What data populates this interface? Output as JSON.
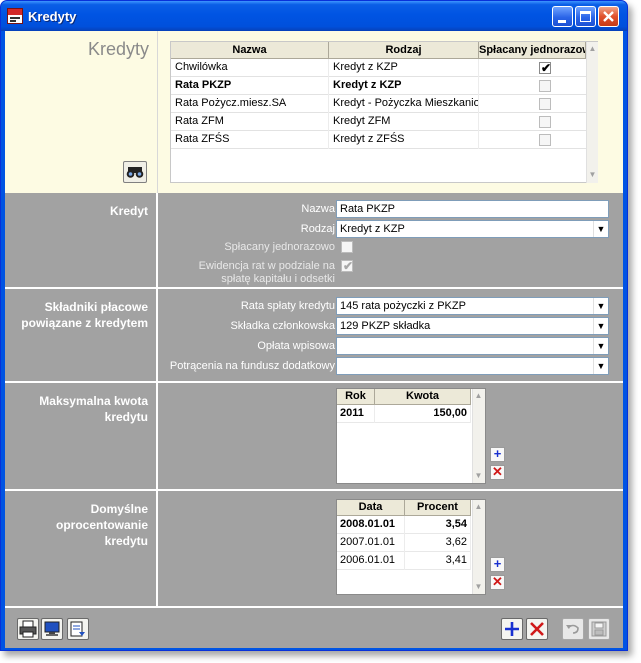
{
  "window": {
    "title": "Kredyty"
  },
  "page_title": "Kredyty",
  "list": {
    "columns": [
      "Nazwa",
      "Rodzaj",
      "Spłacany jednorazowo"
    ],
    "rows": [
      {
        "nazwa": "Chwilówka",
        "rodzaj": "Kredyt z KZP",
        "jednorazowo": true,
        "selected": false
      },
      {
        "nazwa": "Rata PKZP",
        "rodzaj": "Kredyt z KZP",
        "jednorazowo": false,
        "selected": true
      },
      {
        "nazwa": "Rata Pożycz.miesz.SA",
        "rodzaj": "Kredyt - Pożyczka Mieszkanio",
        "jednorazowo": false,
        "selected": false
      },
      {
        "nazwa": "Rata ZFM",
        "rodzaj": "Kredyt ZFM",
        "jednorazowo": false,
        "selected": false
      },
      {
        "nazwa": "Rata ZFŚS",
        "rodzaj": "Kredyt z ZFŚS",
        "jednorazowo": false,
        "selected": false
      }
    ]
  },
  "kredyt": {
    "section_label": "Kredyt",
    "nazwa_label": "Nazwa",
    "nazwa_value": "Rata PKZP",
    "rodzaj_label": "Rodzaj",
    "rodzaj_value": "Kredyt z KZP",
    "jednorazowo_label": "Spłacany jednorazowo",
    "jednorazowo_checked": false,
    "ewidencja_label_1": "Ewidencja rat w podziale na",
    "ewidencja_label_2": "spłatę kapitału i odsetki",
    "ewidencja_checked": true
  },
  "skladniki": {
    "section_label": "Składniki płacowe powiązane z kredytem",
    "rata_label": "Rata spłaty kredytu",
    "rata_value": "145 rata pożyczki z PKZP",
    "skladka_label": "Składka członkowska",
    "skladka_value": "129 PKZP składka",
    "oplata_label": "Opłata wpisowa",
    "oplata_value": "",
    "potracenia_label": "Potrącenia na fundusz dodatkowy",
    "potracenia_value": ""
  },
  "maks": {
    "section_label": "Maksymalna kwota kredytu",
    "columns": [
      "Rok",
      "Kwota"
    ],
    "rows": [
      {
        "rok": "2011",
        "kwota": "150,00"
      }
    ]
  },
  "oprocentowanie": {
    "section_label": "Domyślne oprocentowanie kredytu",
    "columns": [
      "Data",
      "Procent"
    ],
    "rows": [
      {
        "data": "2008.01.01",
        "procent": "3,54",
        "bold": true
      },
      {
        "data": "2007.01.01",
        "procent": "3,62",
        "bold": false
      },
      {
        "data": "2006.01.01",
        "procent": "3,41",
        "bold": false
      }
    ]
  },
  "icons": {
    "find": "binoculars-icon",
    "print": "printer-icon",
    "preview": "monitor-icon",
    "export": "export-icon",
    "add": "plus-icon",
    "delete": "x-icon",
    "undo": "undo-icon",
    "save": "floppy-icon"
  },
  "colors": {
    "titlebar": "#0054e3",
    "panel": "#a2a2a2",
    "list_bg": "#fdfbe3",
    "add": "#1830d0",
    "delete": "#d01818"
  }
}
